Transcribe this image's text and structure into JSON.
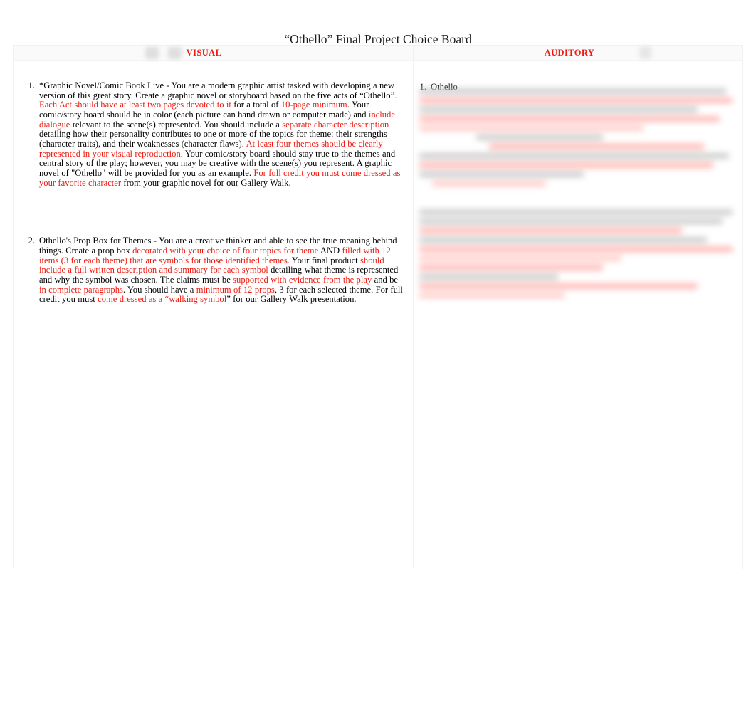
{
  "document": {
    "title": "“Othello” Final Project Choice Board"
  },
  "table": {
    "columns": [
      {
        "id": "visual",
        "label": "VISUAL",
        "accent_color": "#f0180f"
      },
      {
        "id": "auditory",
        "label": "AUDITORY",
        "accent_color": "#f0180f"
      }
    ],
    "header_icons": [
      {
        "name": "obscured-image-icon-1"
      },
      {
        "name": "obscured-image-icon-2"
      },
      {
        "name": "obscured-image-icon-3"
      }
    ]
  },
  "visual_column": {
    "items": [
      {
        "number": "1.",
        "segments": [
          {
            "text": "*Graphic Novel/Comic Book Live ",
            "color": "black"
          },
          {
            "text": " - You are a modern graphic artist tasked with developing a new version of this great story.   Create a graphic novel or storyboard based on the five acts of “Othello”",
            "color": "black"
          },
          {
            "text": ". Each Act should have at least two pages devoted to it",
            "color": "red"
          },
          {
            "text": " for a total of ",
            "color": "black"
          },
          {
            "text": "10-page minimum",
            "color": "red"
          },
          {
            "text": ". Your comic/story board should be in color (each picture can hand drawn or computer made) and ",
            "color": "black"
          },
          {
            "text": "include dialogue",
            "color": "red"
          },
          {
            "text": " relevant to the scene(s) represented. You should include a ",
            "color": "black"
          },
          {
            "text": "separate character description",
            "color": "red"
          },
          {
            "text": " detailing how their personality contributes to one or more of the topics for theme: their strengths (character traits), and their weaknesses (character flaws). ",
            "color": "black"
          },
          {
            "text": "At least four themes should be clearly represented in your visual reproduction",
            "color": "red"
          },
          {
            "text": ". Your comic/story board should stay true to the themes and central story of the play; however, you may be creative with the scene(s) you represent. A graphic novel of \"Othello\" will be provided for you as an example. ",
            "color": "black"
          },
          {
            "text": "For full credit you must come dressed as your favorite character",
            "color": "red"
          },
          {
            "text": " from your graphic novel for our Gallery Walk.",
            "color": "black"
          }
        ]
      },
      {
        "number": "2.",
        "segments": [
          {
            "text": "Othello's Prop Box for Themes ",
            "color": "black"
          },
          {
            "text": "  - You are a creative thinker and able to see the true meaning behind things. Create a prop box ",
            "color": "black"
          },
          {
            "text": "decorated with your choice of four topics for theme",
            "color": "red"
          },
          {
            "text": " AND ",
            "color": "black"
          },
          {
            "text": "filled with 12 items (3 for each theme) that are symbols for those identified themes.",
            "color": "red"
          },
          {
            "text": " Your final product ",
            "color": "black"
          },
          {
            "text": " should include a full written description and summary for each symbol",
            "color": "red"
          },
          {
            "text": " detailing what theme is represented and why the symbol was chosen. The claims must be ",
            "color": "black"
          },
          {
            "text": "supported with evidence from the play",
            "color": "red"
          },
          {
            "text": " and be ",
            "color": "black"
          },
          {
            "text": "in complete paragraphs",
            "color": "red"
          },
          {
            "text": ". You should have a ",
            "color": "black"
          },
          {
            "text": "minimum of 12 props",
            "color": "red"
          },
          {
            "text": ", 3 for each selected theme. For full credit you must ",
            "color": "black"
          },
          {
            "text": "come dressed as a “walking symbol",
            "color": "red"
          },
          {
            "text": "” for our Gallery Walk presentation.",
            "color": "black"
          }
        ]
      }
    ]
  },
  "auditory_column": {
    "items": [
      {
        "number": "1.",
        "text": "Othello"
      }
    ],
    "obscured_note": "remaining auditory column content is blurred and unreadable"
  }
}
